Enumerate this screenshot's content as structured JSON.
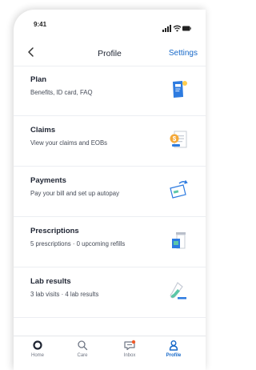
{
  "status": {
    "time": "9:41"
  },
  "header": {
    "title": "Profile",
    "settings_label": "Settings"
  },
  "rows": [
    {
      "title": "Plan",
      "subtitle": "Benefits, ID card, FAQ",
      "icon": "id-card-icon"
    },
    {
      "title": "Claims",
      "subtitle": "View your claims and EOBs",
      "icon": "claims-document-icon"
    },
    {
      "title": "Payments",
      "subtitle": "Pay your bill and set up autopay",
      "icon": "payment-card-icon"
    },
    {
      "title": "Prescriptions",
      "subtitle": "5 prescriptions · 0 upcoming refills",
      "icon": "pill-bottle-icon"
    },
    {
      "title": "Lab results",
      "subtitle": "3 lab visits · 4 lab results",
      "icon": "test-tube-icon"
    }
  ],
  "tabs": [
    {
      "label": "Home",
      "icon": "home-icon"
    },
    {
      "label": "Care",
      "icon": "search-icon"
    },
    {
      "label": "Inbox",
      "icon": "inbox-icon",
      "badge": true
    },
    {
      "label": "Profile",
      "icon": "profile-icon",
      "active": true
    }
  ],
  "colors": {
    "accent": "#1769c9",
    "badge": "#f05a28",
    "divider": "#eceef2",
    "text": "#1f2533"
  }
}
